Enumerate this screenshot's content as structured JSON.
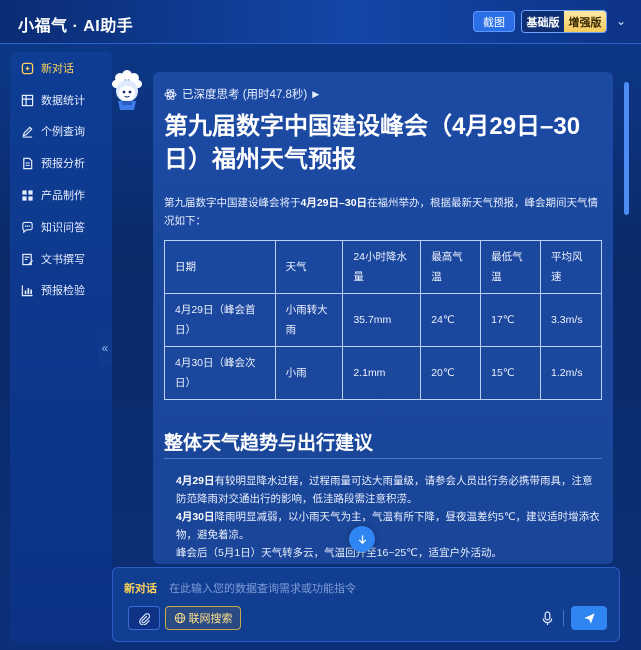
{
  "header": {
    "app_title": "小福气 · AI助手",
    "screenshot_label": "截图",
    "version_basic": "基础版",
    "version_plus": "增强版"
  },
  "sidebar": {
    "items": [
      {
        "label": "新对话",
        "icon": "new-chat-icon",
        "active": true
      },
      {
        "label": "数据统计",
        "icon": "data-stats-icon",
        "active": false
      },
      {
        "label": "个例查询",
        "icon": "pen-icon",
        "active": false
      },
      {
        "label": "预报分析",
        "icon": "document-icon",
        "active": false
      },
      {
        "label": "产品制作",
        "icon": "grid-icon",
        "active": false
      },
      {
        "label": "知识问答",
        "icon": "chat-bubble-icon",
        "active": false
      },
      {
        "label": "文书撰写",
        "icon": "write-doc-icon",
        "active": false
      },
      {
        "label": "预报检验",
        "icon": "bar-chart-icon",
        "active": false
      }
    ],
    "collapse_glyph": "«"
  },
  "message": {
    "think_label": "已深度思考 (用时47.8秒)",
    "title": "第九届数字中国建设峰会（4月29日–30日）福州天气预报",
    "intro_pre": "第九届数字中国建设峰会将于",
    "intro_bold": "4月29日–30日",
    "intro_post": "在福州举办，根据最新天气预报，峰会期间天气情况如下：",
    "table": {
      "headers": [
        "日期",
        "天气",
        "24小时降水量",
        "最高气温",
        "最低气温",
        "平均风速"
      ],
      "rows": [
        [
          "4月29日（峰会首日）",
          "小雨转大雨",
          "35.7mm",
          "24℃",
          "17℃",
          "3.3m/s"
        ],
        [
          "4月30日（峰会次日）",
          "小雨",
          "2.1mm",
          "20℃",
          "15℃",
          "1.2m/s"
        ]
      ]
    },
    "section_title": "整体天气趋势与出行建议",
    "advice": [
      {
        "bold": "4月29日",
        "text": "有较明显降水过程，过程雨量可达大雨量级，请参会人员出行务必携带雨具，注意防范降雨对交通出行的影响，低洼路段需注意积涝。"
      },
      {
        "bold": "4月30日",
        "text": "降雨明显减弱，以小雨天气为主，气温有所下降，昼夜温差约5℃，建议适时增添衣物，避免着凉。"
      },
      {
        "bold": "",
        "text": "峰会后（5月1日）天气转多云，气温回升至16~25℃，适宜户外活动。"
      }
    ]
  },
  "input": {
    "new_chat_label": "新对话",
    "placeholder": "在此输入您的数据查询需求或功能指令",
    "web_search_label": "联网搜索"
  },
  "colors": {
    "accent_blue": "#2f86f2",
    "active_yellow": "#ffd35a",
    "panel_bg": "#1c4aa3"
  }
}
